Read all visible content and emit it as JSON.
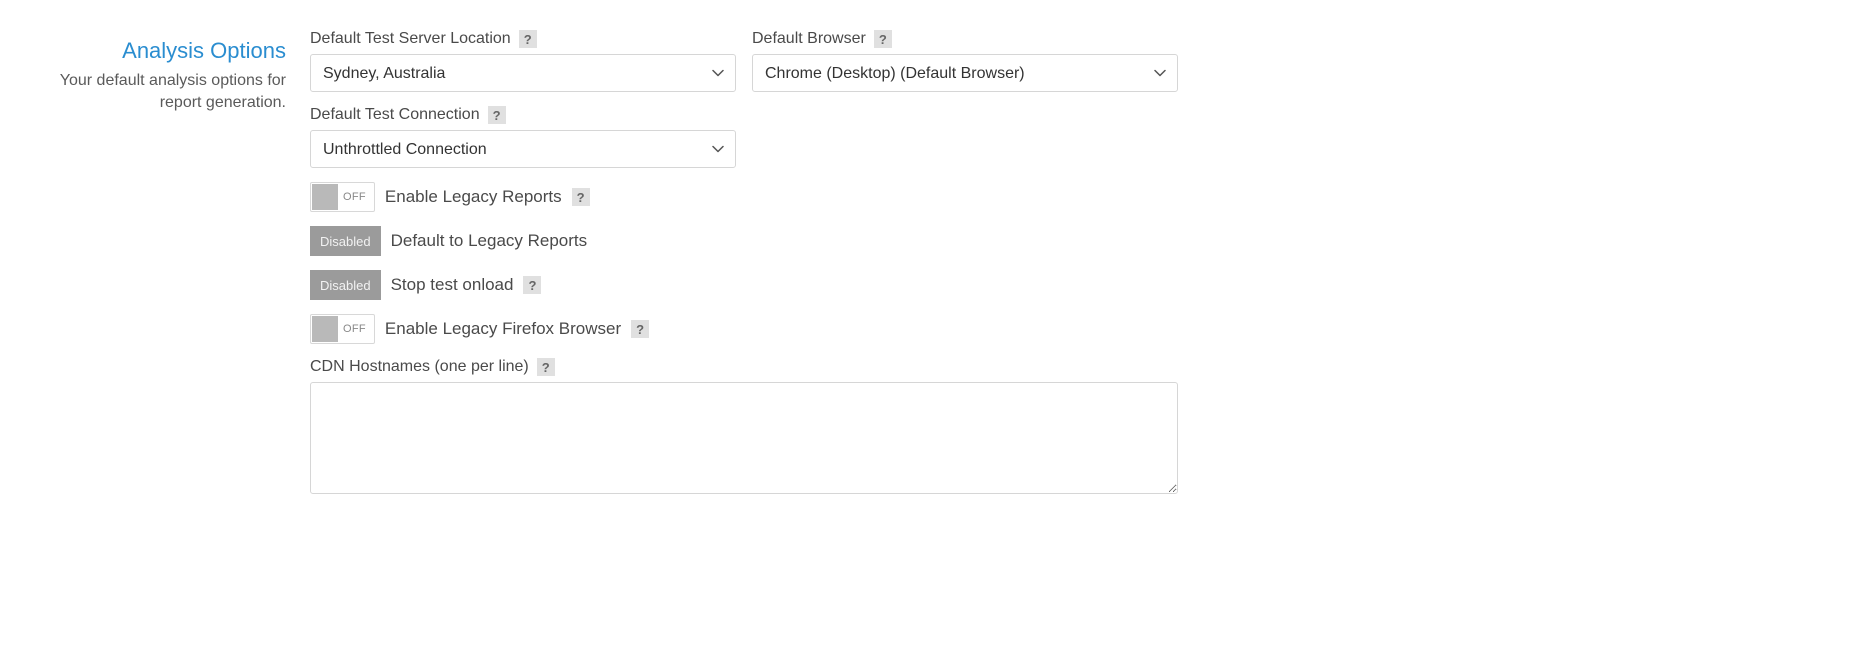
{
  "section": {
    "title": "Analysis Options",
    "description": "Your default analysis options for report generation."
  },
  "fields": {
    "server_location": {
      "label": "Default Test Server Location",
      "value": "Sydney, Australia"
    },
    "browser": {
      "label": "Default Browser",
      "value": "Chrome (Desktop) (Default Browser)"
    },
    "connection": {
      "label": "Default Test Connection",
      "value": "Unthrottled Connection"
    },
    "cdn_hostnames": {
      "label": "CDN Hostnames (one per line)",
      "value": ""
    }
  },
  "toggles": {
    "enable_legacy_reports": {
      "state": "OFF",
      "label": "Enable Legacy Reports"
    },
    "default_legacy_reports": {
      "state": "Disabled",
      "label": "Default to Legacy Reports"
    },
    "stop_test_onload": {
      "state": "Disabled",
      "label": "Stop test onload"
    },
    "enable_legacy_firefox": {
      "state": "OFF",
      "label": "Enable Legacy Firefox Browser"
    }
  },
  "help_glyph": "?"
}
